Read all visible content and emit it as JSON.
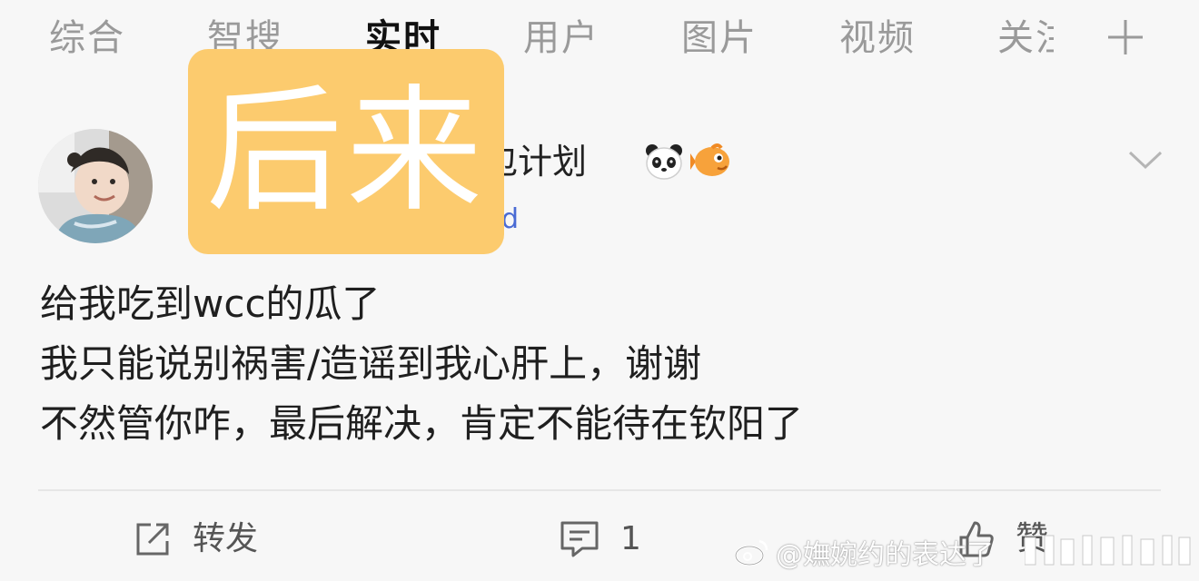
{
  "tabs": [
    {
      "label": "综合"
    },
    {
      "label": "智搜"
    },
    {
      "label": "实时"
    },
    {
      "label": "用户"
    },
    {
      "label": "图片"
    },
    {
      "label": "视频"
    },
    {
      "label": "关注"
    }
  ],
  "active_tab": "实时",
  "add_tab_icon": "plus-icon",
  "overlay": {
    "text": "后来",
    "color": "#fccb6e"
  },
  "post": {
    "username_visible": "包计划",
    "emojis": [
      "panda-icon",
      "fish-icon"
    ],
    "meta_visible": "d",
    "lines": [
      "给我吃到wcc的瓜了",
      "我只能说别祸害/造谣到我心肝上，谢谢",
      "不然管你咋，最后解决，肯定不能待在钦阳了"
    ],
    "more_icon": "chevron-down-icon"
  },
  "actions": {
    "repost": {
      "label": "转发",
      "icon": "repost-icon"
    },
    "comment": {
      "label": "1",
      "icon": "comment-icon"
    },
    "like": {
      "label": "赞",
      "icon": "thumbs-up-icon"
    }
  },
  "watermark": {
    "text": "@嫵婉约的表达了"
  },
  "colors": {
    "accent": "#ff8200",
    "link": "#4a6bd4",
    "background": "#f7f7f7"
  }
}
